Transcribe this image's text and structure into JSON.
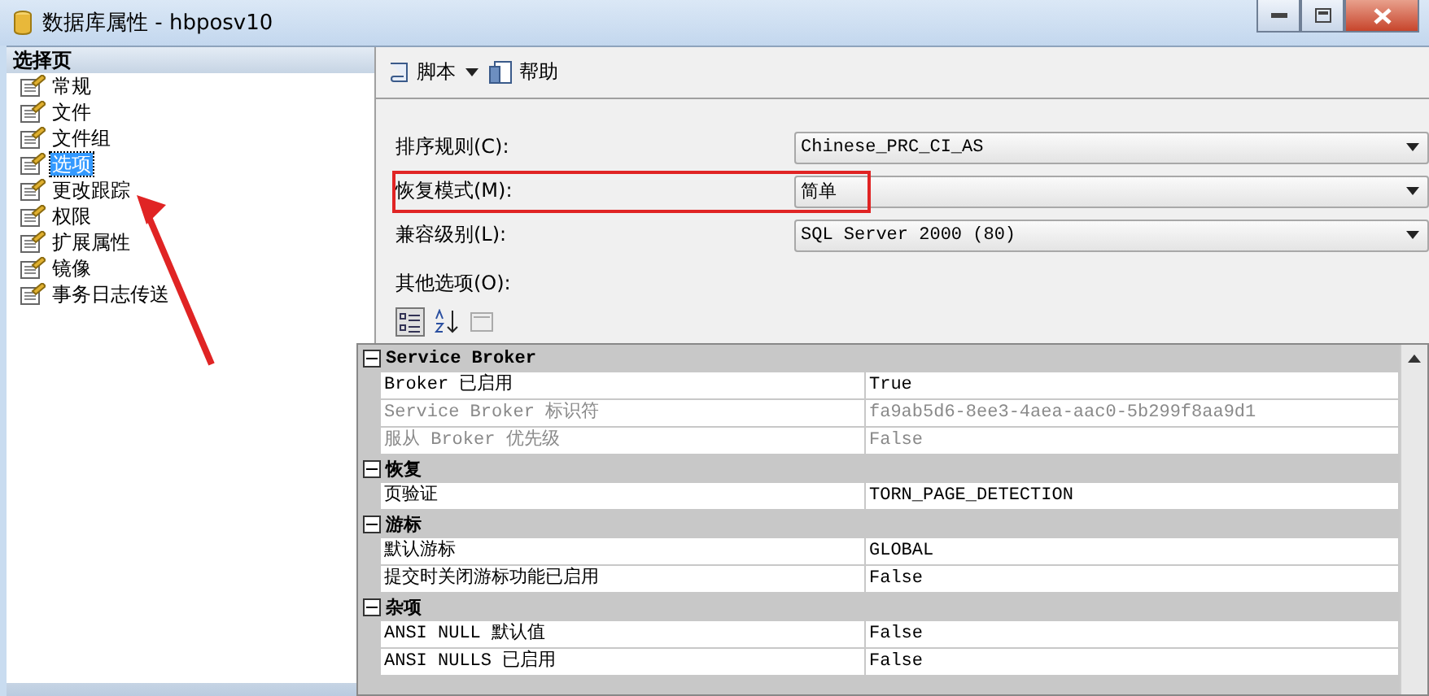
{
  "window": {
    "title": "数据库属性 - hbposv10"
  },
  "sidebar": {
    "header": "选择页",
    "items": [
      {
        "label": "常规",
        "selected": false
      },
      {
        "label": "文件",
        "selected": false
      },
      {
        "label": "文件组",
        "selected": false
      },
      {
        "label": "选项",
        "selected": true
      },
      {
        "label": "更改跟踪",
        "selected": false
      },
      {
        "label": "权限",
        "selected": false
      },
      {
        "label": "扩展属性",
        "selected": false
      },
      {
        "label": "镜像",
        "selected": false
      },
      {
        "label": "事务日志传送",
        "selected": false
      }
    ]
  },
  "toolbar": {
    "script": "脚本",
    "help": "帮助"
  },
  "fields": [
    {
      "label": "排序规则(C):",
      "value": "Chinese_PRC_CI_AS",
      "highlighted": false
    },
    {
      "label": "恢复模式(M):",
      "value": "简单",
      "highlighted": true
    },
    {
      "label": "兼容级别(L):",
      "value": "SQL Server 2000 (80)",
      "highlighted": false
    }
  ],
  "other_options_label": "其他选项(O):",
  "property_grid": [
    {
      "category": "Service Broker",
      "rows": [
        {
          "name": "Broker 已启用",
          "value": "True",
          "disabled": false
        },
        {
          "name": "Service Broker 标识符",
          "value": "fa9ab5d6-8ee3-4aea-aac0-5b299f8aa9d1",
          "disabled": true
        },
        {
          "name": "服从 Broker 优先级",
          "value": "False",
          "disabled": true
        }
      ]
    },
    {
      "category": "恢复",
      "rows": [
        {
          "name": "页验证",
          "value": "TORN_PAGE_DETECTION",
          "disabled": false
        }
      ]
    },
    {
      "category": "游标",
      "rows": [
        {
          "name": "默认游标",
          "value": "GLOBAL",
          "disabled": false
        },
        {
          "name": "提交时关闭游标功能已启用",
          "value": "False",
          "disabled": false
        }
      ]
    },
    {
      "category": "杂项",
      "rows": [
        {
          "name": "ANSI NULL 默认值",
          "value": "False",
          "disabled": false
        },
        {
          "name": "ANSI NULLS 已启用",
          "value": "False",
          "disabled": false
        }
      ]
    }
  ]
}
